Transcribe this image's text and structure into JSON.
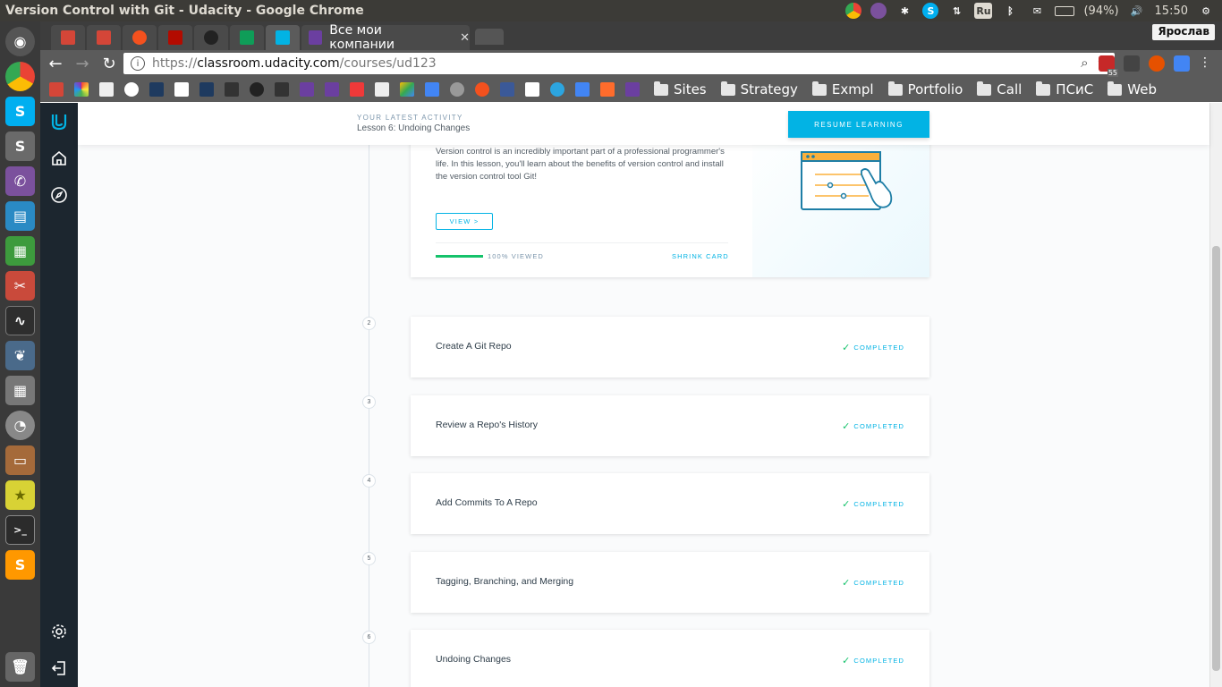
{
  "os": {
    "window_title": "Version Control with Git - Udacity - Google Chrome",
    "battery": "(94%)",
    "clock": "15:50",
    "keyboard_layout": "Ru"
  },
  "browser": {
    "active_tab_title": "Все мои компании",
    "profile_name": "Ярослав",
    "url_scheme": "https://",
    "url_host": "classroom.udacity.com",
    "url_path": "/courses/ud123",
    "ext_badge": "55",
    "bookmark_folders": [
      "Sites",
      "Strategy",
      "Exmpl",
      "Portfolio",
      "Call",
      "ПСиС",
      "Web"
    ]
  },
  "activity": {
    "label": "YOUR LATEST ACTIVITY",
    "lesson": "Lesson 6: Undoing Changes",
    "resume_label": "RESUME LEARNING"
  },
  "featured": {
    "description": "Version control is an incredibly important part of a professional programmer's life. In this lesson, you'll learn about the benefits of version control and install the version control tool Git!",
    "view_label": "VIEW >",
    "progress_percent": 100,
    "viewed_label": "100% VIEWED",
    "shrink_label": "SHRINK CARD"
  },
  "lessons": [
    {
      "number": "2",
      "title": "Create A Git Repo",
      "status": "COMPLETED"
    },
    {
      "number": "3",
      "title": "Review a Repo's History",
      "status": "COMPLETED"
    },
    {
      "number": "4",
      "title": "Add Commits To A Repo",
      "status": "COMPLETED"
    },
    {
      "number": "5",
      "title": "Tagging, Branching, and Merging",
      "status": "COMPLETED"
    },
    {
      "number": "6",
      "title": "Undoing Changes",
      "status": "COMPLETED"
    }
  ],
  "colors": {
    "accent": "#02b3e4",
    "success": "#15c26b",
    "sidebar": "#1c262f"
  }
}
